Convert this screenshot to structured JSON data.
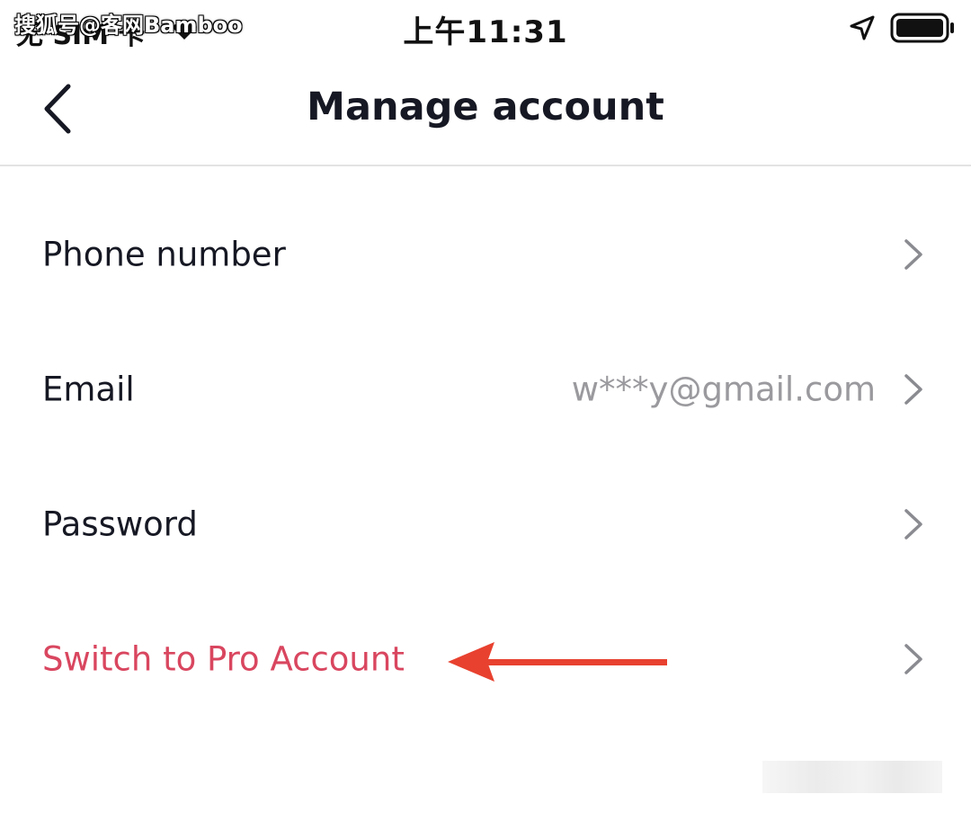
{
  "status_bar": {
    "watermark": "搜狐号@客网Bamboo",
    "carrier": "无 SIM 卡",
    "time": "上午11:31",
    "icons": [
      "wifi-icon",
      "location-arrow-icon",
      "battery-icon"
    ]
  },
  "nav": {
    "back_icon": "chevron-left-icon",
    "title": "Manage account"
  },
  "rows": [
    {
      "label": "Phone number",
      "value": "",
      "icon": "chevron-right-icon"
    },
    {
      "label": "Email",
      "value": "w***y@gmail.com",
      "icon": "chevron-right-icon"
    },
    {
      "label": "Password",
      "value": "",
      "icon": "chevron-right-icon"
    },
    {
      "label": "Switch to Pro Account",
      "value": "",
      "icon": "chevron-right-icon"
    }
  ],
  "annotation": {
    "arrow_icon": "red-arrow-left-icon"
  },
  "colors": {
    "primary_text": "#161823",
    "secondary_text": "#9a9a9e",
    "danger_text": "#d9465f",
    "arrow": "#e8412f",
    "divider": "#e3e3e4",
    "chevron": "#8a8b91"
  }
}
